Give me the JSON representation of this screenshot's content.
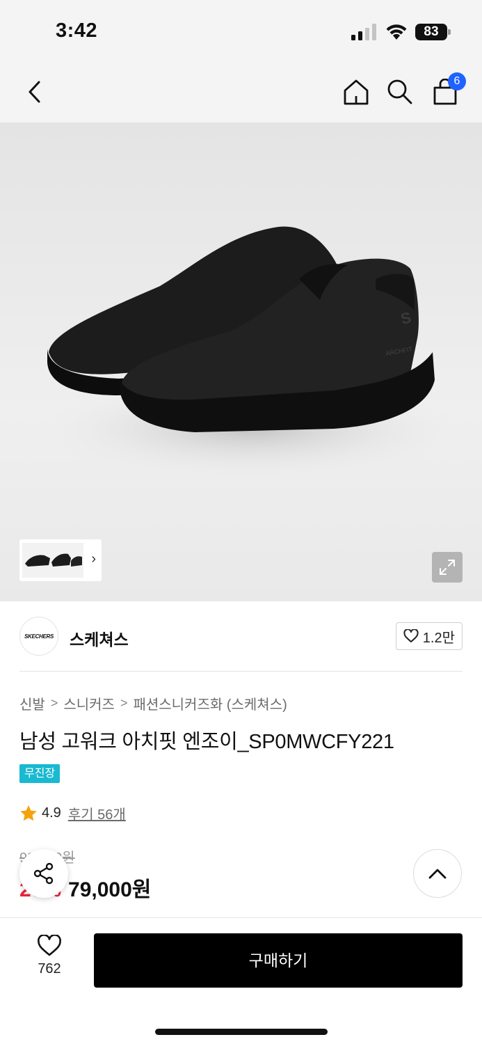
{
  "status_bar": {
    "time": "3:42",
    "battery": "83"
  },
  "nav": {
    "back_icon": "chevron-left-icon",
    "home_icon": "home-icon",
    "search_icon": "search-icon",
    "cart_icon": "shopping-bag-icon",
    "cart_count": "6"
  },
  "gallery": {
    "thumbnail_more_icon": "chevron-right-icon",
    "expand_icon": "expand-icon"
  },
  "brand": {
    "logo_text": "SKECHERS",
    "name": "스케쳐스",
    "like_count": "1.2만"
  },
  "product": {
    "breadcrumb": [
      "신발",
      "스니커즈",
      "패션스니커즈화 (스케쳐스)"
    ],
    "breadcrumb_sep": ">",
    "title": "남성 고워크 아치핏 엔조이_SP0MWCFY221",
    "tag": "무진장",
    "rating": "4.9",
    "review_link": "후기 56개",
    "original_price": "99,000원",
    "discount": "20%",
    "sale_price": "79,000원"
  },
  "bottom_bar": {
    "wish_count": "762",
    "buy_label": "구매하기"
  },
  "colors": {
    "accent_blue": "#1f62ff",
    "tag_cyan": "#18b9d1",
    "discount_red": "#e8243b",
    "star_orange": "#f5a30c",
    "buy_button": "#000000"
  }
}
